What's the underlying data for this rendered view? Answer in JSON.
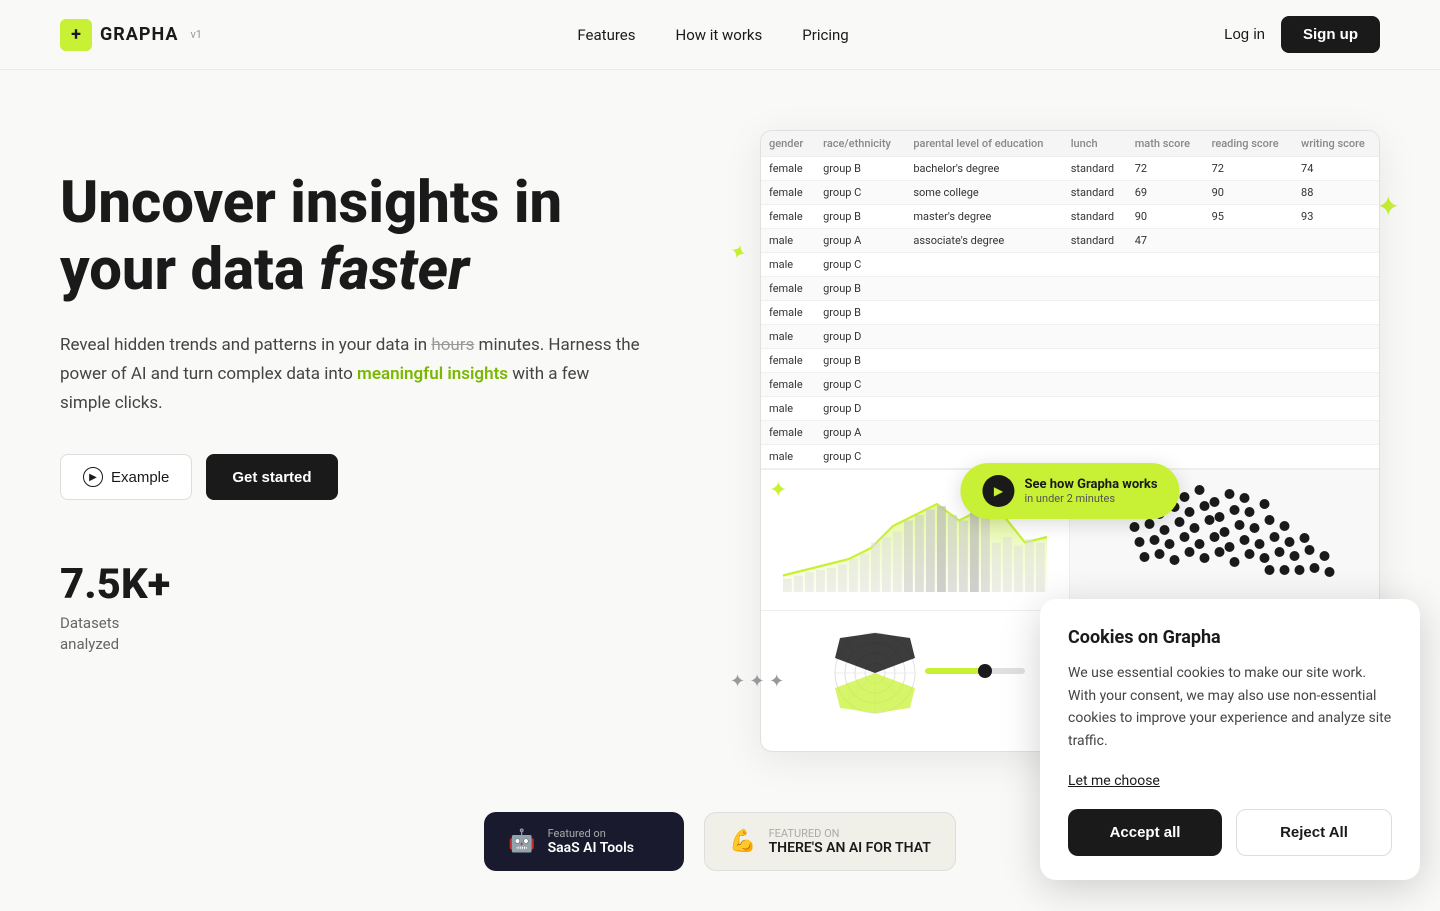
{
  "nav": {
    "logo_text": "GRAPHA",
    "logo_version": "v1",
    "logo_icon": "+",
    "links": [
      {
        "label": "Features",
        "id": "features"
      },
      {
        "label": "How it works",
        "id": "how-it-works"
      },
      {
        "label": "Pricing",
        "id": "pricing"
      }
    ],
    "login_label": "Log in",
    "signup_label": "Sign up"
  },
  "hero": {
    "title_part1": "Uncover insights in your data ",
    "title_italic": "faster",
    "desc_part1": "Reveal hidden trends and patterns in your data in ",
    "desc_strikethrough": "hours",
    "desc_part2": " minutes. Harness the power of AI and turn complex data into ",
    "desc_highlight": "meaningful insights",
    "desc_part3": " with a few simple clicks.",
    "example_label": "Example",
    "getstarted_label": "Get started",
    "stat_number": "7.5K+",
    "stat_label_line1": "Datasets",
    "stat_label_line2": "analyzed"
  },
  "dashboard": {
    "table_headers": [
      "gender",
      "race/ethnicity",
      "parental level of education",
      "lunch",
      "math score",
      "reading score",
      "writing score"
    ],
    "table_rows": [
      [
        "female",
        "group B",
        "bachelor's degree",
        "standard",
        "72",
        "72",
        "74"
      ],
      [
        "female",
        "group C",
        "some college",
        "standard",
        "69",
        "90",
        "88"
      ],
      [
        "female",
        "group B",
        "master's degree",
        "standard",
        "90",
        "95",
        "93"
      ],
      [
        "male",
        "group A",
        "associate's degree",
        "standard",
        "47",
        "",
        ""
      ],
      [
        "male",
        "group C",
        "",
        "",
        "",
        "",
        ""
      ],
      [
        "female",
        "group B",
        "",
        "",
        "",
        "",
        ""
      ],
      [
        "female",
        "group B",
        "",
        "",
        "",
        "",
        ""
      ],
      [
        "male",
        "group D",
        "",
        "",
        "",
        "",
        ""
      ],
      [
        "female",
        "group B",
        "",
        "",
        "",
        "",
        ""
      ],
      [
        "female",
        "group C",
        "",
        "",
        "",
        "",
        ""
      ],
      [
        "male",
        "group D",
        "",
        "",
        "",
        "",
        ""
      ],
      [
        "female",
        "group A",
        "",
        "",
        "",
        "",
        ""
      ],
      [
        "male",
        "group C",
        "",
        "",
        "",
        "",
        ""
      ]
    ],
    "play_label": "See how Grapha works",
    "play_sublabel": "in under 2 minutes"
  },
  "badges": [
    {
      "icon": "🤖",
      "label_small": "Featured on",
      "label_main": "SaaS AI Tools",
      "style": "dark"
    },
    {
      "icon": "💪",
      "label_small": "FEATURED ON",
      "label_main": "THERE'S AN AI FOR THAT",
      "style": "light"
    }
  ],
  "cookie": {
    "title": "Cookies on Grapha",
    "desc": "We use essential cookies to make our site work. With your consent, we may also use non-essential cookies to improve your experience and analyze site traffic.",
    "link_label": "Let me choose",
    "accept_label": "Accept all",
    "reject_label": "Reject All"
  },
  "decorations": {
    "star_color": "#c8f135"
  }
}
